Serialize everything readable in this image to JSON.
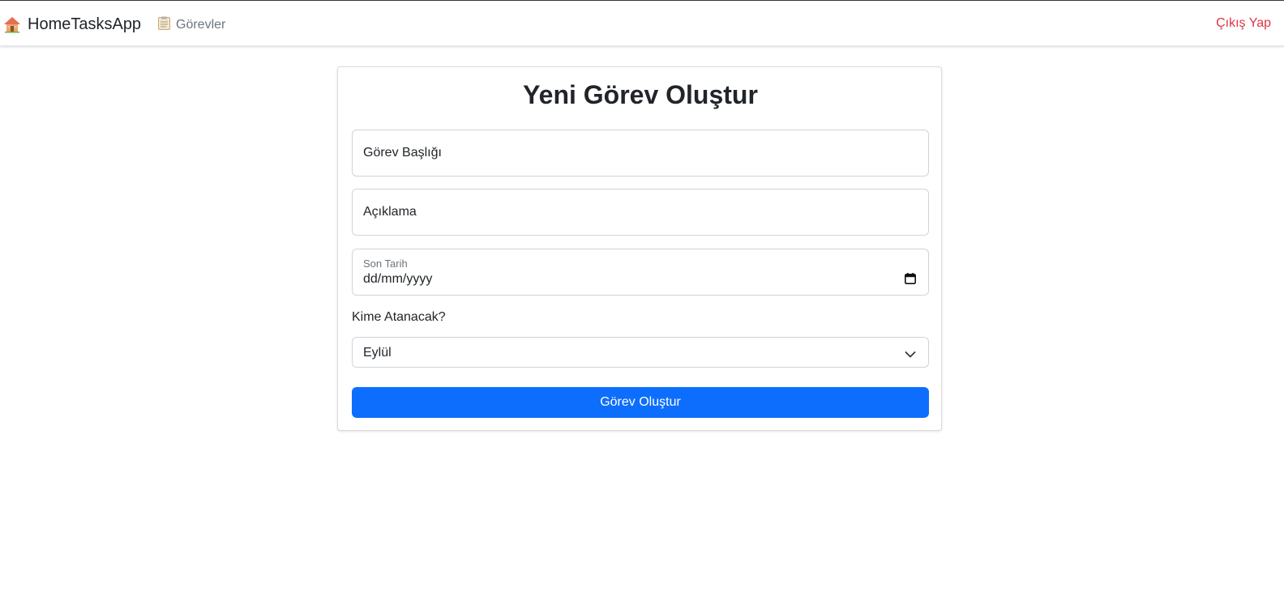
{
  "navbar": {
    "brand_label": "HomeTasksApp",
    "brand_icon": "house-icon",
    "tasks_link_label": "Görevler",
    "tasks_link_icon": "clipboard-icon",
    "logout_label": "Çıkış Yap",
    "logout_color": "#dc3545"
  },
  "form": {
    "title": "Yeni Görev Oluştur",
    "title_placeholder": "Görev Başlığı",
    "description_placeholder": "Açıklama",
    "due_date_label": "Son Tarih",
    "due_date_value": "dd/mm/yyyy",
    "assignee_label": "Kime Atanacak?",
    "assignee_selected": "Eylül",
    "submit_label": "Görev Oluştur",
    "accent_color": "#0d6efd"
  }
}
